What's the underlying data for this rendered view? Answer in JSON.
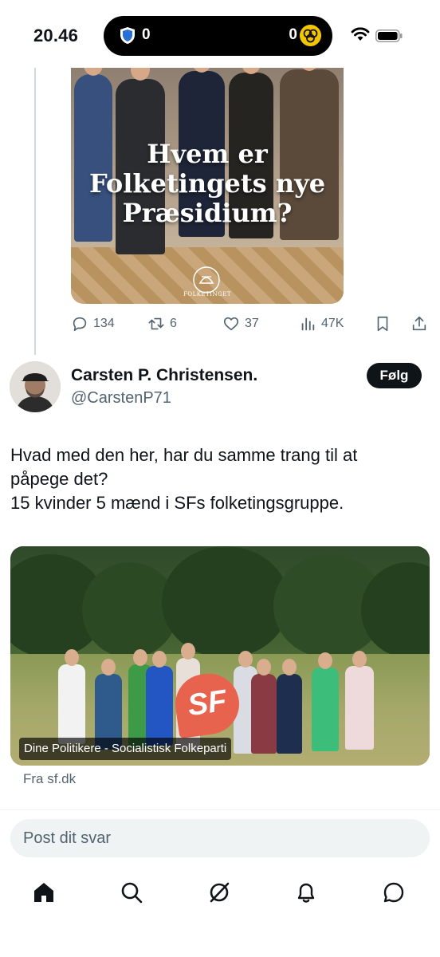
{
  "status_bar": {
    "time": "20.46",
    "island_left_count": "0",
    "island_right_count": "0",
    "icons": [
      "shield-icon",
      "coin-icon",
      "wifi-icon",
      "battery-icon"
    ]
  },
  "quoted_post": {
    "image_headline": [
      "Hvem er",
      "Folketingets nye",
      "Præsidium?"
    ],
    "image_logo_text": "FOLKETINGET",
    "actions": {
      "replies": "134",
      "reposts": "6",
      "likes": "37",
      "views": "47K"
    }
  },
  "reply": {
    "display_name": "Carsten P. Christensen.",
    "handle": "@CarstenP71",
    "follow_label": "Følg",
    "text_lines": [
      "Hvad med den her, har du samme trang til at",
      "påpege det?",
      "15 kvinder 5 mænd i SFs folketingsgruppe."
    ],
    "link_card": {
      "caption": "Dine Politikere - Socialistisk Folkeparti",
      "badge_text": "SF",
      "source": "Fra sf.dk"
    }
  },
  "composer": {
    "placeholder": "Post dit svar"
  },
  "tabbar": {
    "items": [
      "home-icon",
      "search-icon",
      "grok-icon",
      "notifications-icon",
      "messages-icon"
    ]
  },
  "colors": {
    "text": "#0f1419",
    "secondary": "#536471",
    "thread_line": "#cfd9de",
    "follow_bg": "#0f1419",
    "sf_orange": "#e8634d"
  }
}
